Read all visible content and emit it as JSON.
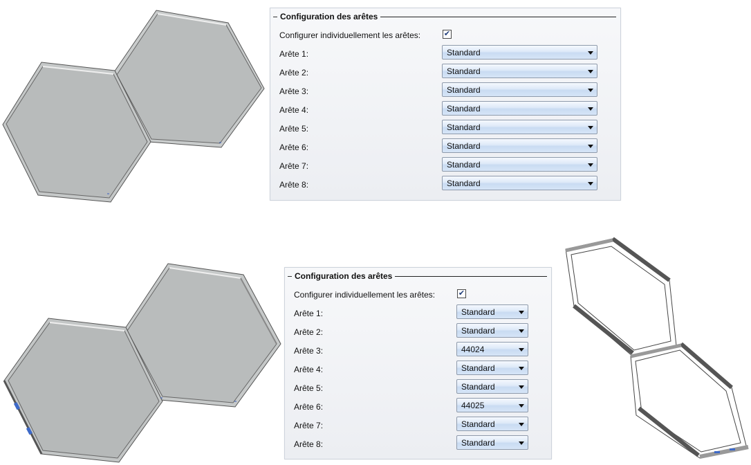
{
  "top_panel": {
    "title": "Configuration des arêtes",
    "checkbox_label": "Configurer individuellement les arêtes:",
    "checkbox_checked": true,
    "edges": [
      {
        "label": "Arête 1:",
        "value": "Standard"
      },
      {
        "label": "Arête 2:",
        "value": "Standard"
      },
      {
        "label": "Arête 3:",
        "value": "Standard"
      },
      {
        "label": "Arête 4:",
        "value": "Standard"
      },
      {
        "label": "Arête 5:",
        "value": "Standard"
      },
      {
        "label": "Arête 6:",
        "value": "Standard"
      },
      {
        "label": "Arête 7:",
        "value": "Standard"
      },
      {
        "label": "Arête 8:",
        "value": "Standard"
      }
    ]
  },
  "bottom_panel": {
    "title": "Configuration des arêtes",
    "checkbox_label": "Configurer individuellement les arêtes:",
    "checkbox_checked": true,
    "edges": [
      {
        "label": "Arête 1:",
        "value": "Standard"
      },
      {
        "label": "Arête 2:",
        "value": "Standard"
      },
      {
        "label": "Arête 3:",
        "value": "44024"
      },
      {
        "label": "Arête 4:",
        "value": "Standard"
      },
      {
        "label": "Arête 5:",
        "value": "Standard"
      },
      {
        "label": "Arête 6:",
        "value": "44025"
      },
      {
        "label": "Arête 7:",
        "value": "Standard"
      },
      {
        "label": "Arête 8:",
        "value": "Standard"
      }
    ]
  },
  "colors": {
    "panel_border": "#cdd3dc",
    "dropdown_blue": "#c9dbf2",
    "model_face": "#b8bbbb",
    "model_edge": "#4a4d50"
  }
}
